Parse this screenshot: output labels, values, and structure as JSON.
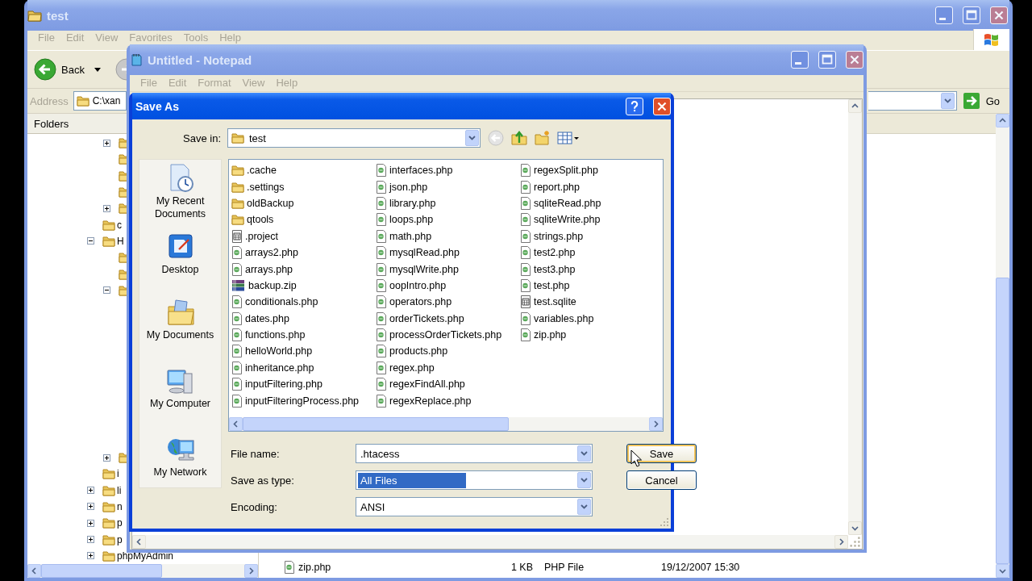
{
  "explorer": {
    "title": "test",
    "menu": [
      "File",
      "Edit",
      "View",
      "Favorites",
      "Tools",
      "Help"
    ],
    "back": "Back",
    "address_label": "Address",
    "address": "C:\\xan",
    "go": "Go",
    "folders_header": "Folders",
    "tree": [
      {
        "kind": "group",
        "children": [
          {
            "kind": "folder",
            "expanded": false
          },
          {
            "kind": "folder"
          },
          {
            "kind": "folder"
          },
          {
            "kind": "folder"
          },
          {
            "kind": "folder",
            "expanded": false
          }
        ]
      },
      {
        "kind": "folder",
        "label": "c"
      },
      {
        "kind": "folder",
        "label": "H",
        "expanded": true,
        "children": [
          {
            "kind": "folder"
          },
          {
            "kind": "folder"
          },
          {
            "kind": "folder",
            "expanded": true
          },
          {
            "kind": "folder",
            "expanded": false
          }
        ]
      },
      {
        "kind": "folder",
        "label": "i"
      },
      {
        "kind": "folder",
        "label": "li",
        "expanded": false
      },
      {
        "kind": "folder",
        "label": "n",
        "expanded": false
      },
      {
        "kind": "folder",
        "label": "p",
        "expanded": false
      },
      {
        "kind": "folder",
        "label": "p",
        "expanded": false
      },
      {
        "kind": "folder",
        "label": "phpMyAdmin",
        "expanded": false
      }
    ],
    "file_row": {
      "name": "zip.php",
      "size": "1 KB",
      "type": "PHP File",
      "modified": "19/12/2007 15:30"
    }
  },
  "notepad": {
    "title": "Untitled - Notepad",
    "menu": [
      "File",
      "Edit",
      "Format",
      "View",
      "Help"
    ]
  },
  "save_as": {
    "title": "Save As",
    "save_in_label": "Save in:",
    "save_in": "test",
    "places": [
      {
        "kind": "recent",
        "label": "My Recent Documents"
      },
      {
        "kind": "desktop",
        "label": "Desktop"
      },
      {
        "kind": "documents",
        "label": "My Documents"
      },
      {
        "kind": "computer",
        "label": "My Computer"
      },
      {
        "kind": "network",
        "label": "My Network"
      }
    ],
    "files": [
      {
        "kind": "folder",
        "name": ".cache"
      },
      {
        "kind": "folder",
        "name": ".settings"
      },
      {
        "kind": "folder",
        "name": "oldBackup"
      },
      {
        "kind": "folder",
        "name": "qtools"
      },
      {
        "kind": "file",
        "name": ".project"
      },
      {
        "kind": "php",
        "name": "arrays2.php"
      },
      {
        "kind": "php",
        "name": "arrays.php"
      },
      {
        "kind": "zip",
        "name": "backup.zip"
      },
      {
        "kind": "php",
        "name": "conditionals.php"
      },
      {
        "kind": "php",
        "name": "dates.php"
      },
      {
        "kind": "php",
        "name": "functions.php"
      },
      {
        "kind": "php",
        "name": "helloWorld.php"
      },
      {
        "kind": "php",
        "name": "inheritance.php"
      },
      {
        "kind": "php",
        "name": "inputFiltering.php"
      },
      {
        "kind": "php",
        "name": "inputFilteringProcess.php"
      },
      {
        "kind": "php",
        "name": "interfaces.php"
      },
      {
        "kind": "php",
        "name": "json.php"
      },
      {
        "kind": "php",
        "name": "library.php"
      },
      {
        "kind": "php",
        "name": "loops.php"
      },
      {
        "kind": "php",
        "name": "math.php"
      },
      {
        "kind": "php",
        "name": "mysqlRead.php"
      },
      {
        "kind": "php",
        "name": "mysqlWrite.php"
      },
      {
        "kind": "php",
        "name": "oopIntro.php"
      },
      {
        "kind": "php",
        "name": "operators.php"
      },
      {
        "kind": "php",
        "name": "orderTickets.php"
      },
      {
        "kind": "php",
        "name": "processOrderTickets.php"
      },
      {
        "kind": "php",
        "name": "products.php"
      },
      {
        "kind": "php",
        "name": "regex.php"
      },
      {
        "kind": "php",
        "name": "regexFindAll.php"
      },
      {
        "kind": "php",
        "name": "regexReplace.php"
      },
      {
        "kind": "php",
        "name": "regexSplit.php"
      },
      {
        "kind": "php",
        "name": "report.php"
      },
      {
        "kind": "php",
        "name": "sqliteRead.php"
      },
      {
        "kind": "php",
        "name": "sqliteWrite.php"
      },
      {
        "kind": "php",
        "name": "strings.php"
      },
      {
        "kind": "php",
        "name": "test2.php"
      },
      {
        "kind": "php",
        "name": "test3.php"
      },
      {
        "kind": "php",
        "name": "test.php"
      },
      {
        "kind": "file",
        "name": "test.sqlite"
      },
      {
        "kind": "php",
        "name": "variables.php"
      },
      {
        "kind": "php",
        "name": "zip.php"
      }
    ],
    "fields": [
      {
        "label": "File name:",
        "value": ".htacess",
        "selected": false
      },
      {
        "label": "Save as type:",
        "value": "All Files",
        "selected": true
      },
      {
        "label": "Encoding:",
        "value": "ANSI",
        "selected": false
      }
    ],
    "buttons": [
      {
        "label": "Save",
        "default": true
      },
      {
        "label": "Cancel",
        "default": false
      }
    ]
  }
}
